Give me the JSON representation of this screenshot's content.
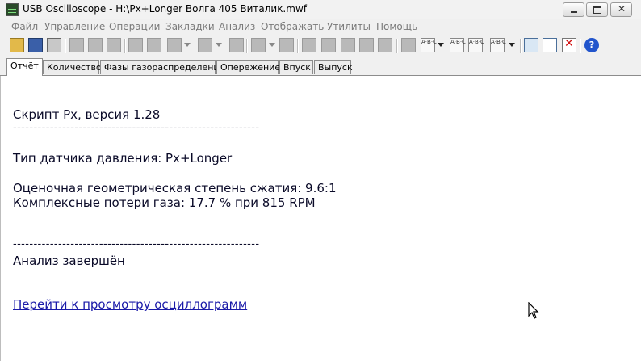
{
  "window": {
    "title": "USB Oscilloscope - H:\\Px+Longer Волга 405 Виталик.mwf"
  },
  "menu": [
    "Файл",
    "Управление",
    "Операции",
    "Закладки",
    "Анализ",
    "Отображать",
    "Утилиты",
    "Помощь"
  ],
  "toolbar": {
    "icons": [
      "open-icon",
      "save-icon",
      "print-icon",
      "copy-icon",
      "paste-icon",
      "cut-icon",
      "cursor-icon",
      "spectrum-icon",
      "measure-icon",
      "zoom-icon",
      "undo-icon",
      "filter-icon",
      "check-icon",
      "check-all-icon",
      "check-down-icon",
      "document-icon",
      "abc-icon",
      "abc-arrow-icon",
      "abc-run-icon",
      "abc-stop-icon",
      "abc-table-icon",
      "waveform-icon",
      "report-icon",
      "close-red-icon",
      "help-icon"
    ],
    "help_label": "?",
    "abc_label": "A·B·C"
  },
  "tabs": [
    "Отчёт",
    "Количество",
    "Фазы газораспределения",
    "Опережение",
    "Впуск",
    "Выпуск"
  ],
  "report": {
    "title": "Скрипт Px, версия 1.28",
    "separator": "------------------------------------------------------------",
    "sensor": "Тип датчика давления: Px+Longer",
    "compression": "Оценочная геометрическая степень сжатия: 9.6:1",
    "gas_loss": "Комплексные потери газа: 17.7 % при 815 RPM",
    "separator2": "------------------------------------------------------------",
    "done": "Анализ завершён",
    "link": "Перейти к просмотру осциллограмм"
  }
}
